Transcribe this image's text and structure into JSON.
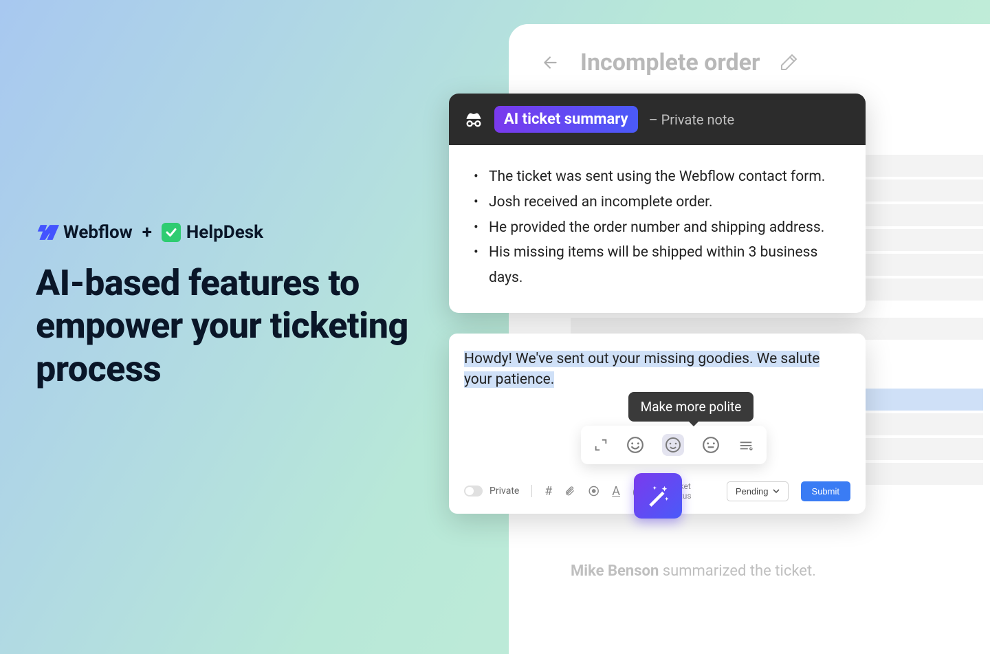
{
  "left": {
    "webflow_text": "Webflow",
    "plus": "+",
    "helpdesk_text": "HelpDesk",
    "headline": "AI-based features to empower your ticketing process"
  },
  "app": {
    "title": "Incomplete order"
  },
  "summary": {
    "badge": "AI ticket summary",
    "private_note": "– Private note",
    "items": [
      "The ticket was sent using the Webflow contact form.",
      "Josh received an incomplete order.",
      "He provided the order number and shipping address.",
      "His missing items will be shipped within 3 business days."
    ]
  },
  "composer": {
    "reply": "Howdy! We've sent out your missing goodies. We salute your patience.",
    "tooltip": "Make more polite",
    "private_label": "Private",
    "ticket_status_label": "Ticket status",
    "pending_label": "Pending",
    "submit_label": "Submit"
  },
  "footer": {
    "actor": "Mike Benson",
    "action": " summarized the ticket."
  },
  "tone_icons": [
    "expand",
    "happy",
    "smile",
    "neutral",
    "summarize"
  ]
}
